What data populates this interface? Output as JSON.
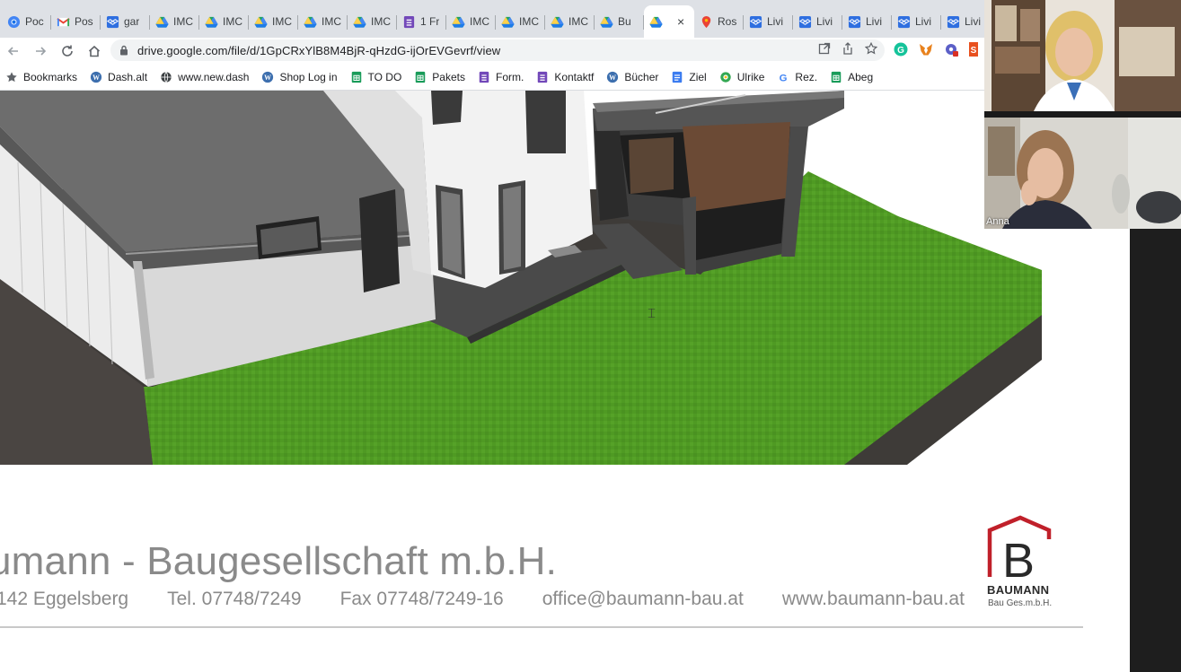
{
  "browser": {
    "tabs": [
      {
        "title": "Poc",
        "icon": "chrome-icon"
      },
      {
        "title": "Pos",
        "icon": "gmail-icon"
      },
      {
        "title": "gar",
        "icon": "dropbox-icon"
      },
      {
        "title": "IMC",
        "icon": "google-drive-icon"
      },
      {
        "title": "IMC",
        "icon": "google-drive-icon"
      },
      {
        "title": "IMC",
        "icon": "google-drive-icon"
      },
      {
        "title": "IMC",
        "icon": "google-drive-icon"
      },
      {
        "title": "IMC",
        "icon": "google-drive-icon"
      },
      {
        "title": "1 Fr",
        "icon": "google-forms-icon"
      },
      {
        "title": "IMC",
        "icon": "google-drive-icon"
      },
      {
        "title": "IMC",
        "icon": "google-drive-icon"
      },
      {
        "title": "IMC",
        "icon": "google-drive-icon"
      },
      {
        "title": "Bu",
        "icon": "google-drive-icon"
      },
      {
        "title": "",
        "icon": "google-drive-icon",
        "active": true,
        "close": "×"
      },
      {
        "title": "Ros",
        "icon": "maps-pin-icon"
      },
      {
        "title": "Livi",
        "icon": "dropbox-icon"
      },
      {
        "title": "Livi",
        "icon": "dropbox-icon"
      },
      {
        "title": "Livi",
        "icon": "dropbox-icon"
      },
      {
        "title": "Livi",
        "icon": "dropbox-icon"
      },
      {
        "title": "Livi",
        "icon": "dropbox-icon"
      }
    ],
    "url": "drive.google.com/file/d/1GpCRxYlB8M4BjR-qHzdG-ijOrEVGevrf/view",
    "bookmarks": [
      {
        "label": "Bookmarks",
        "icon": "star-icon"
      },
      {
        "label": "Dash.alt",
        "icon": "wordpress-icon"
      },
      {
        "label": "www.new.dash",
        "icon": "globe-icon"
      },
      {
        "label": "Shop Log in",
        "icon": "wordpress-icon"
      },
      {
        "label": "TO DO",
        "icon": "google-sheets-icon"
      },
      {
        "label": "Pakets",
        "icon": "google-sheets-icon"
      },
      {
        "label": "Form.",
        "icon": "google-forms-icon"
      },
      {
        "label": "Kontaktf",
        "icon": "google-forms-icon"
      },
      {
        "label": "Bücher",
        "icon": "wordpress-icon"
      },
      {
        "label": "Ziel",
        "icon": "google-docs-icon"
      },
      {
        "label": "Ulrike",
        "icon": "extension-icon"
      },
      {
        "label": "Rez.",
        "icon": "google-icon"
      },
      {
        "label": "Abeg",
        "icon": "google-sheets-icon"
      }
    ]
  },
  "document": {
    "company_name": "umann - Baugesellschaft m.b.H.",
    "contact": {
      "address": "142 Eggelsberg",
      "tel": "Tel. 07748/7249",
      "fax": "Fax 07748/7249-16",
      "email": "office@baumann-bau.at",
      "web": "www.baumann-bau.at"
    },
    "logo_word": "BAUMANN",
    "logo_sub": "Bau Ges.m.b.H."
  },
  "video_call": {
    "participants": [
      {
        "name": ""
      },
      {
        "name": "Anna"
      }
    ]
  },
  "colors": {
    "tab_strip": "#dee1e6",
    "grass": "#4f9a23",
    "logo_red": "#c0202a",
    "footer_text": "#8a8a8a"
  }
}
